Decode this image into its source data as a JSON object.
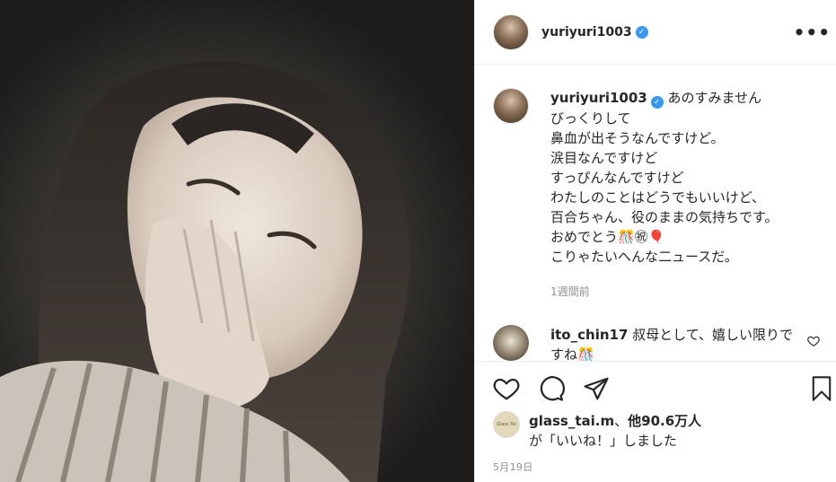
{
  "post": {
    "username": "yuriyuri1003",
    "verified_mark": "✓",
    "more_icon_label": "•••",
    "caption_lines": [
      "あのすみません",
      "びっくりして",
      "鼻血が出そうなんですけど。",
      "涙目なんですけど",
      "すっぴんなんですけど",
      "わたしのことはどうでもいいけど、",
      "百合ちゃん、役のままの気持ちです。",
      "おめでとう🎊㊗🎈",
      "こりゃたいへんな二ュースだ。"
    ],
    "time_ago": "1週間前"
  },
  "comment": {
    "username": "ito_chin17",
    "text": "叔母として、嬉しい限りですね🎊"
  },
  "actions": {
    "icons": [
      "heart-icon",
      "comment-icon",
      "share-icon",
      "bookmark-icon"
    ]
  },
  "likes": {
    "avatar_text": "Glass Tai",
    "user": "glass_tai.m",
    "sep": "、",
    "others": "他90.6万人",
    "suffix": "が「いいね！」しました"
  },
  "date": "5月19日",
  "colors": {
    "verified": "#3897f0",
    "muted": "#8e8e8e",
    "border": "#efefef"
  }
}
